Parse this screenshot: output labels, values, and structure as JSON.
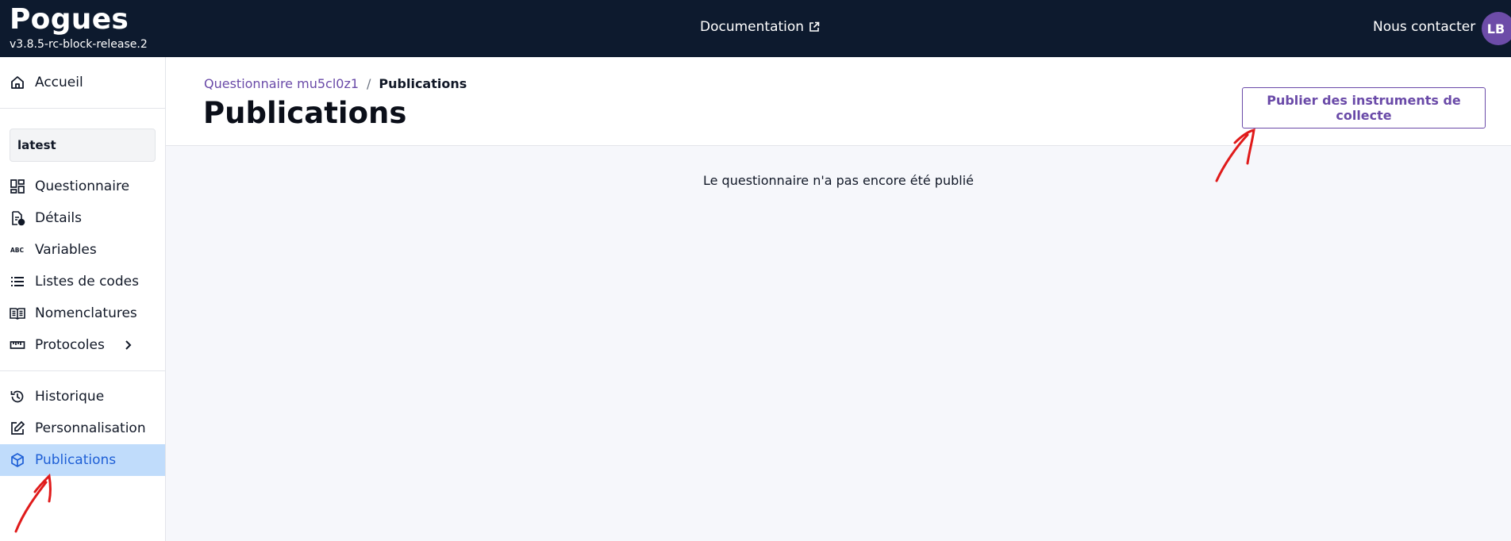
{
  "app": {
    "name": "Pogues",
    "version": "v3.8.5-rc-block-release.2"
  },
  "topbar": {
    "documentation_label": "Documentation",
    "contact_label": "Nous contacter",
    "avatar_initials": "LB"
  },
  "sidebar": {
    "home_label": "Accueil",
    "version_selector": "latest",
    "items": [
      {
        "label": "Questionnaire",
        "icon": "dashboard-icon"
      },
      {
        "label": "Détails",
        "icon": "document-info-icon"
      },
      {
        "label": "Variables",
        "icon": "abc-icon"
      },
      {
        "label": "Listes de codes",
        "icon": "list-icon"
      },
      {
        "label": "Nomenclatures",
        "icon": "book-icon"
      },
      {
        "label": "Protocoles",
        "icon": "ruler-icon"
      }
    ],
    "bottom_items": [
      {
        "label": "Historique",
        "icon": "history-icon"
      },
      {
        "label": "Personnalisation",
        "icon": "edit-icon"
      },
      {
        "label": "Publications",
        "icon": "cube-icon",
        "active": true
      }
    ]
  },
  "breadcrumb": {
    "parent": "Questionnaire mu5cl0z1",
    "separator": "/",
    "current": "Publications"
  },
  "page": {
    "title": "Publications",
    "publish_button_label": "Publier des instruments de collecte",
    "empty_message": "Le questionnaire n'a pas encore été publié"
  },
  "colors": {
    "topbar_bg": "#0d1a2e",
    "accent_purple": "#6a4aa8",
    "active_bg": "#c0dcfb",
    "active_text": "#1e5fd6",
    "annotation_red": "#e01b1b"
  }
}
